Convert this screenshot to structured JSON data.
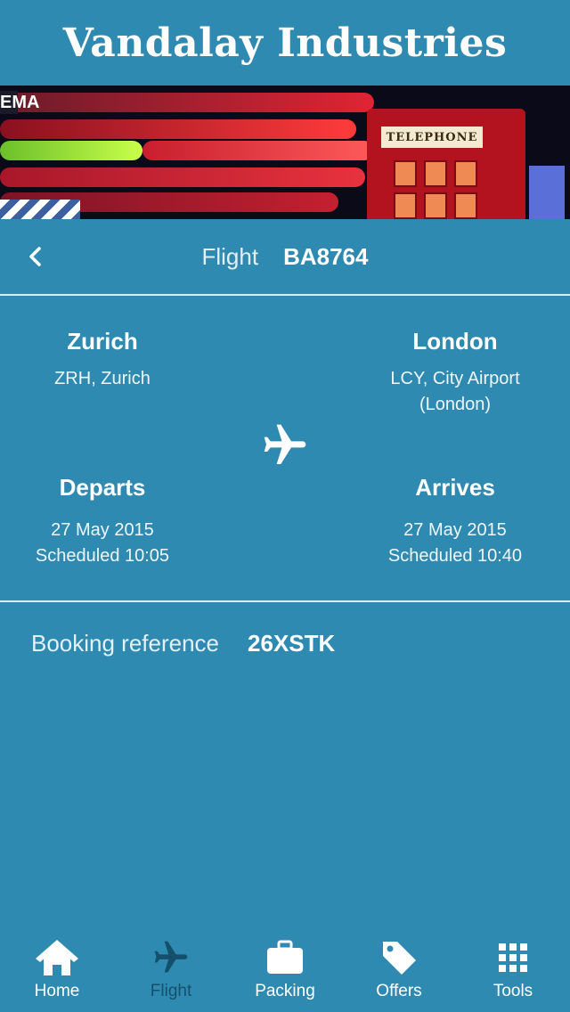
{
  "app": {
    "title": "Vandalay Industries"
  },
  "banner": {
    "booth_sign": "TELEPHONE",
    "side_letters": "EMA"
  },
  "flight": {
    "label": "Flight",
    "code": "BA8764",
    "origin": {
      "city": "Zurich",
      "airport": "ZRH, Zurich"
    },
    "destination": {
      "city": "London",
      "airport_line1": "LCY, City Airport",
      "airport_line2": "(London)"
    },
    "departs": {
      "label": "Departs",
      "date": "27 May 2015",
      "time": "Scheduled 10:05"
    },
    "arrives": {
      "label": "Arrives",
      "date": "27 May 2015",
      "time": "Scheduled 10:40"
    }
  },
  "booking": {
    "label": "Booking reference",
    "code": "26XSTK"
  },
  "tabs": [
    {
      "label": "Home",
      "icon": "home-icon",
      "active": false
    },
    {
      "label": "Flight",
      "icon": "plane-icon",
      "active": true
    },
    {
      "label": "Packing",
      "icon": "suitcase-icon",
      "active": false
    },
    {
      "label": "Offers",
      "icon": "tag-icon",
      "active": false
    },
    {
      "label": "Tools",
      "icon": "grid-icon",
      "active": false
    }
  ],
  "colors": {
    "background": "#2f8ab2",
    "active_tab": "#14506b",
    "divider": "#d9ebf3"
  }
}
